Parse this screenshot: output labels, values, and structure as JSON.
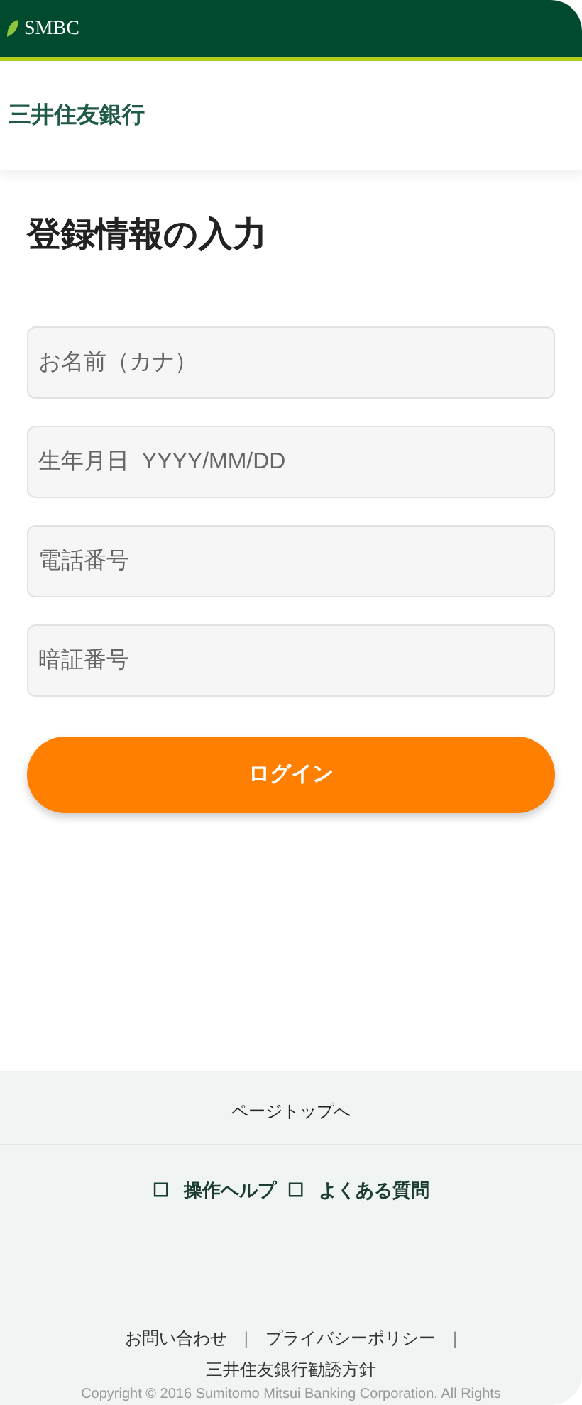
{
  "header": {
    "logo_text": "SMBC"
  },
  "bank_name": "三井住友銀行",
  "title": "登録情報の入力",
  "fields": [
    {
      "placeholder": "お名前（カナ）"
    },
    {
      "placeholder": "生年月日  YYYY/MM/DD"
    },
    {
      "placeholder": "電話番号"
    },
    {
      "placeholder": "暗証番号"
    }
  ],
  "login_button": "ログイン",
  "footer": {
    "page_top": "ページトップへ",
    "help_links": [
      {
        "box": "☐",
        "label": "操作ヘルプ"
      },
      {
        "box": "☐",
        "label": "よくある質問"
      }
    ],
    "links": [
      "お問い合わせ",
      "プライバシーポリシー"
    ],
    "separators": [
      "|",
      "|"
    ],
    "policy_link": "三井住友銀行勧誘方針",
    "copyright": "Copyright © 2016 Sumitomo Mitsui Banking Corporation. All Rights"
  }
}
